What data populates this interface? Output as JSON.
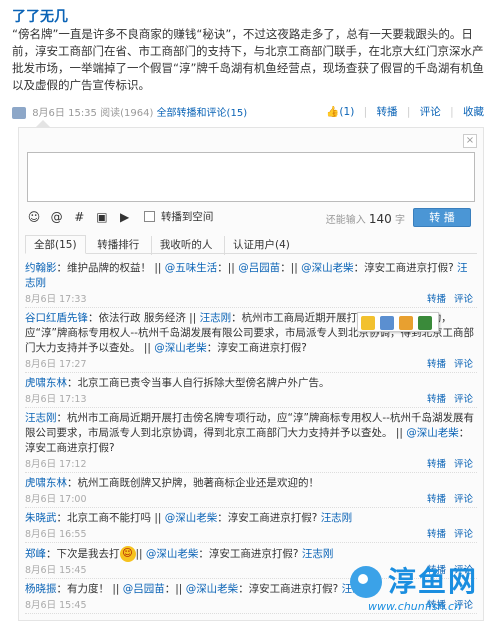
{
  "post": {
    "author": "了了无几",
    "text": "“傍名牌”一直是许多不良商家的赚钱“秘诀”，不过这夜路走多了，总有一天要栽跟头的。日前，淳安工商部门在省、市工商部门的支持下，与北京工商部门联手，在北京大红门京深水产批发市场，一举端掉了一个假冒“淳”牌千岛湖有机鱼经营点，现场查获了假冒的千岛湖有机鱼以及虚假的广告宣传标识。",
    "time": "8月6日 15:35",
    "views": "阅读(1964)",
    "all_reposts": "全部转播和评论(15)",
    "actions": [
      "(1)",
      "转播",
      "评论",
      "收藏"
    ]
  },
  "composer": {
    "remaining_label": "还能输入",
    "remaining_count": "140",
    "remaining_unit": "字",
    "repost_to_space": "转播到空间",
    "submit_label": "转 播",
    "close": "×"
  },
  "tabs": [
    "全部(15)",
    "转播排行",
    "我收听的人",
    "认证用户(4)"
  ],
  "comments": [
    {
      "name": "约翰影",
      "segments": [
        {
          "t": "：维护品牌的权益！ || ",
          "k": "text"
        },
        {
          "t": "@五味生活",
          "k": "link"
        },
        {
          "t": "：|| ",
          "k": "text"
        },
        {
          "t": "@吕园苗",
          "k": "link"
        },
        {
          "t": "：|| ",
          "k": "text"
        },
        {
          "t": "@深山老柴",
          "k": "link"
        },
        {
          "t": "：淳安工商进京打假? ",
          "k": "text"
        },
        {
          "t": "汪志刚",
          "k": "link"
        }
      ],
      "time": "8月6日 17:33",
      "acts": [
        "转播",
        "评论"
      ]
    },
    {
      "name": "谷口红盾先锋",
      "segments": [
        {
          "t": "：依法行政 服务经济 || ",
          "k": "text"
        },
        {
          "t": "汪志刚",
          "k": "link"
        },
        {
          "t": "：杭州市工商局近期开展打击傍名牌专项行动，应“淳”牌商标专用权人--杭州千岛湖发展有限公司要求，市局派专人到北京协调，得到北京工商部门大力支持并予以查处。 || ",
          "k": "text"
        },
        {
          "t": "@深山老柴",
          "k": "link"
        },
        {
          "t": "：淳安工商进京打假?",
          "k": "text"
        }
      ],
      "time": "8月6日 17:27",
      "acts": [
        "转播",
        "评论"
      ]
    },
    {
      "name": "虎啸东林",
      "segments": [
        {
          "t": "：北京工商已责令当事人自行拆除大型傍名牌户外广告。",
          "k": "text"
        }
      ],
      "time": "8月6日 17:13",
      "acts": [
        "转播",
        "评论"
      ]
    },
    {
      "name": "汪志刚",
      "segments": [
        {
          "t": "：杭州市工商局近期开展打击傍名牌专项行动，应“淳”牌商标专用权人--杭州千岛湖发展有限公司要求，市局派专人到北京协调，得到北京工商部门大力支持并予以查处。 || ",
          "k": "text"
        },
        {
          "t": "@深山老柴",
          "k": "link"
        },
        {
          "t": "：淳安工商进京打假?",
          "k": "text"
        }
      ],
      "time": "8月6日 17:12",
      "acts": [
        "转播",
        "评论"
      ]
    },
    {
      "name": "虎啸东林",
      "segments": [
        {
          "t": "：杭州工商既创牌又护牌，驰著商标企业还是欢迎的！",
          "k": "text"
        }
      ],
      "time": "8月6日 17:00",
      "acts": [
        "转播",
        "评论"
      ]
    },
    {
      "name": "朱晓武",
      "segments": [
        {
          "t": "：北京工商不能打吗 || ",
          "k": "text"
        },
        {
          "t": "@深山老柴",
          "k": "link"
        },
        {
          "t": "：淳安工商进京打假? ",
          "k": "text"
        },
        {
          "t": "汪志刚",
          "k": "link"
        }
      ],
      "time": "8月6日 16:55",
      "acts": [
        "转播",
        "评论"
      ]
    },
    {
      "name": "郑峰",
      "segments": [
        {
          "t": "：下次是我去打",
          "k": "text"
        },
        {
          "t": "EMO",
          "k": "emo"
        },
        {
          "t": "|| ",
          "k": "text"
        },
        {
          "t": "@深山老柴",
          "k": "link"
        },
        {
          "t": "：淳安工商进京打假? ",
          "k": "text"
        },
        {
          "t": "汪志刚",
          "k": "link"
        }
      ],
      "time": "8月6日 15:45",
      "acts": [
        "转播",
        "评论"
      ]
    },
    {
      "name": "杨晓振",
      "segments": [
        {
          "t": "：有力度！ || ",
          "k": "text"
        },
        {
          "t": "@吕园苗",
          "k": "link"
        },
        {
          "t": "：|| ",
          "k": "text"
        },
        {
          "t": "@深山老柴",
          "k": "link"
        },
        {
          "t": "：淳安工商进京打假? ",
          "k": "text"
        },
        {
          "t": "汪志刚",
          "k": "link"
        }
      ],
      "time": "8月6日 15:45",
      "acts": [
        "转播",
        "评论"
      ]
    }
  ],
  "watermark": {
    "title": "淳鱼网",
    "url": "www.chunfish.cn"
  },
  "colors": {
    "link": "#0a63b6",
    "submit": "#4b96d5",
    "watermark": "#1a8ee0"
  }
}
